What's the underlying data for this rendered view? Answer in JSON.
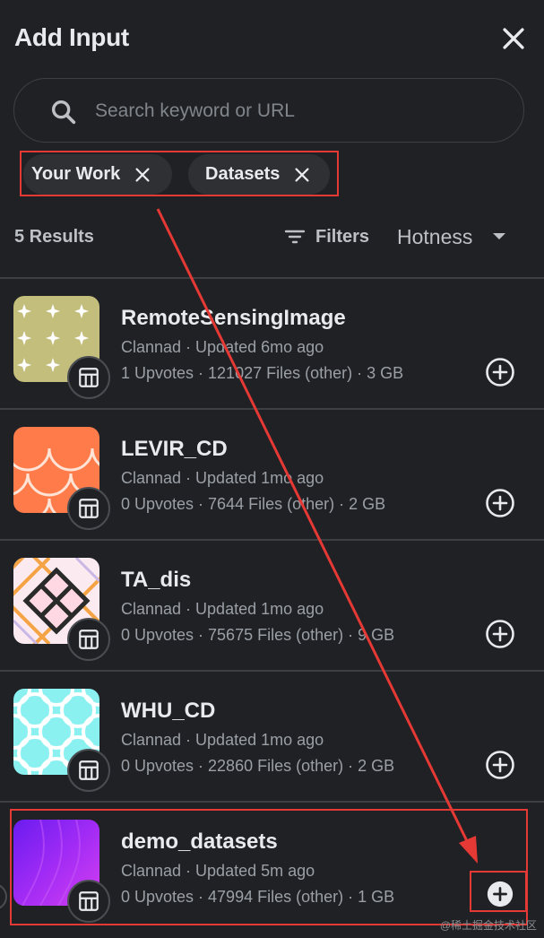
{
  "header": {
    "title": "Add Input"
  },
  "search": {
    "placeholder": "Search keyword or URL",
    "value": ""
  },
  "chips": [
    {
      "label": "Your Work"
    },
    {
      "label": "Datasets"
    }
  ],
  "results": {
    "count_label": "5 Results",
    "filters_label": "Filters",
    "sort_label": "Hotness"
  },
  "items": [
    {
      "name": "RemoteSensingImage",
      "meta1": "Clannad · Updated 6mo ago",
      "meta2": "1 Upvotes · 121027 Files (other) · 3 GB",
      "thumb": "olive-stars"
    },
    {
      "name": "LEVIR_CD",
      "meta1": "Clannad · Updated 1mo ago",
      "meta2": "0 Upvotes · 7644 Files (other) · 2 GB",
      "thumb": "orange-scales"
    },
    {
      "name": "TA_dis",
      "meta1": "Clannad · Updated 1mo ago",
      "meta2": "0 Upvotes · 75675 Files (other) · 9 GB",
      "thumb": "diamond-lattice"
    },
    {
      "name": "WHU_CD",
      "meta1": "Clannad · Updated 1mo ago",
      "meta2": "0 Upvotes · 22860 Files (other) · 2 GB",
      "thumb": "cyan-quatrefoil"
    },
    {
      "name": "demo_datasets",
      "meta1": "Clannad · Updated 5m ago",
      "meta2": "0 Upvotes · 47994 Files (other) · 1 GB",
      "thumb": "purple-gradient"
    }
  ],
  "watermark": "@稀土掘金技术社区",
  "icons": {
    "close": "close-icon",
    "search": "search-icon",
    "chip_remove": "close-icon",
    "filters": "filter-icon",
    "sort": "caret-down-icon",
    "dataset_badge": "dataset-table-icon",
    "add": "add-circle-icon"
  },
  "colors": {
    "background": "#202124",
    "annotation": "#e53935",
    "text": "#e8eaed",
    "muted": "#9aa0a6"
  }
}
